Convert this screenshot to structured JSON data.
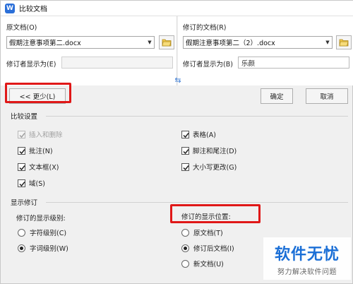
{
  "window": {
    "title": "比较文档",
    "app_icon_letter": "W"
  },
  "original": {
    "label": "原文档(O)",
    "file": "假期注意事项第二.docx",
    "author_label": "修订者显示为(E)",
    "author_value": ""
  },
  "revised": {
    "label": "修订的文档(R)",
    "file": "假期注意事项第二（2）.docx",
    "author_label": "修订者显示为(B)",
    "author_value": "乐颜"
  },
  "buttons": {
    "less": "<< 更少(L)",
    "ok": "确定",
    "cancel": "取消"
  },
  "compare_settings": {
    "title": "比较设置",
    "left": [
      {
        "label": "插入和删除",
        "checked": true,
        "disabled": true
      },
      {
        "label": "批注(N)",
        "checked": true,
        "disabled": false
      },
      {
        "label": "文本框(X)",
        "checked": true,
        "disabled": false
      },
      {
        "label": "域(S)",
        "checked": true,
        "disabled": false
      }
    ],
    "right": [
      {
        "label": "表格(A)",
        "checked": true,
        "disabled": false
      },
      {
        "label": "脚注和尾注(D)",
        "checked": true,
        "disabled": false
      },
      {
        "label": "大小写更改(G)",
        "checked": true,
        "disabled": false
      }
    ]
  },
  "show_revisions": {
    "title": "显示修订",
    "level_title": "修订的显示级别:",
    "levels": [
      {
        "label": "字符级别(C)",
        "selected": false
      },
      {
        "label": "字词级别(W)",
        "selected": true
      }
    ],
    "location_title": "修订的显示位置:",
    "locations": [
      {
        "label": "原文档(T)",
        "selected": false
      },
      {
        "label": "修订后文档(I)",
        "selected": true
      },
      {
        "label": "新文档(U)",
        "selected": false
      }
    ]
  },
  "watermark": {
    "main": "软件无忧",
    "sub": "努力解决软件问题"
  },
  "colors": {
    "highlight": "#e01818",
    "accent": "#2b6fd8",
    "watermark": "#1b6fd6"
  }
}
